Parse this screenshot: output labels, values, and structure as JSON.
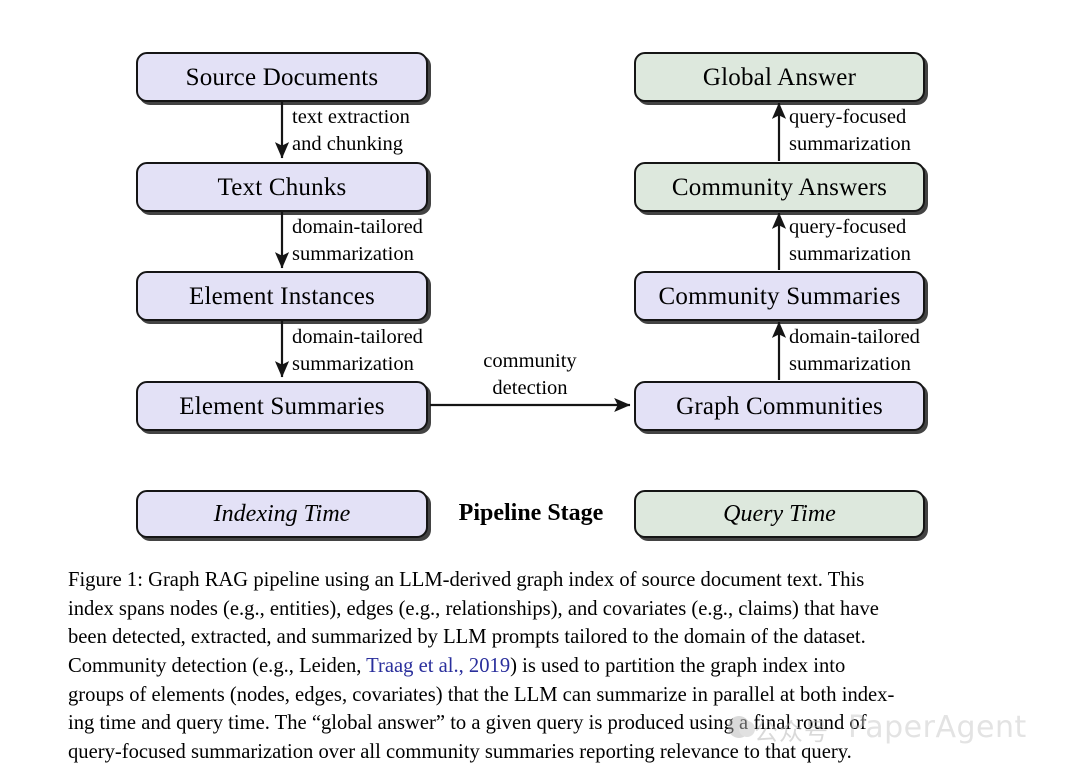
{
  "figure": {
    "label": "Figure 1:",
    "diagram_title": "Graph RAG pipeline"
  },
  "colors": {
    "indexing_fill": "#e3e1f6",
    "query_fill": "#dde8dd",
    "stroke": "#151515",
    "citation_link": "#2a2f9c",
    "watermark": "#c6c6c6"
  },
  "nodes": {
    "source_documents": "Source Documents",
    "text_chunks": "Text Chunks",
    "element_instances": "Element Instances",
    "element_summaries": "Element Summaries",
    "graph_communities": "Graph Communities",
    "community_summaries": "Community Summaries",
    "community_answers": "Community Answers",
    "global_answer": "Global Answer"
  },
  "edges": {
    "text_extraction_line1": "text extraction",
    "text_extraction_line2": "and chunking",
    "domain_tailored_1_line1": "domain-tailored",
    "domain_tailored_1_line2": "summarization",
    "domain_tailored_2_line1": "domain-tailored",
    "domain_tailored_2_line2": "summarization",
    "community_detection_line1": "community",
    "community_detection_line2": "detection",
    "domain_tailored_3_line1": "domain-tailored",
    "domain_tailored_3_line2": "summarization",
    "query_focused_1_line1": "query-focused",
    "query_focused_1_line2": "summarization",
    "query_focused_2_line1": "query-focused",
    "query_focused_2_line2": "summarization"
  },
  "legend": {
    "indexing_time": "Indexing Time",
    "pipeline_stage": "Pipeline Stage",
    "query_time": "Query Time"
  },
  "caption": {
    "line1": "Figure 1: Graph RAG pipeline using an LLM-derived graph index of source document text. This",
    "line2": "index spans nodes (e.g., entities), edges (e.g., relationships), and covariates (e.g., claims) that have",
    "line3": "been detected, extracted, and summarized by LLM prompts tailored to the domain of the dataset.",
    "line4_pre": "Community detection (e.g., Leiden, ",
    "line4_cite": "Traag et al., 2019",
    "line4_post": ") is used to partition the graph index into",
    "line5": "groups of elements (nodes, edges, covariates) that the LLM can summarize in parallel at both index-",
    "line6": "ing time and query time. The “global answer” to a given query is produced using a final round of",
    "line7": "query-focused summarization over all community summaries reporting relevance to that query."
  },
  "watermark": {
    "cn_text": "公众号",
    "brand": "PaperAgent"
  }
}
